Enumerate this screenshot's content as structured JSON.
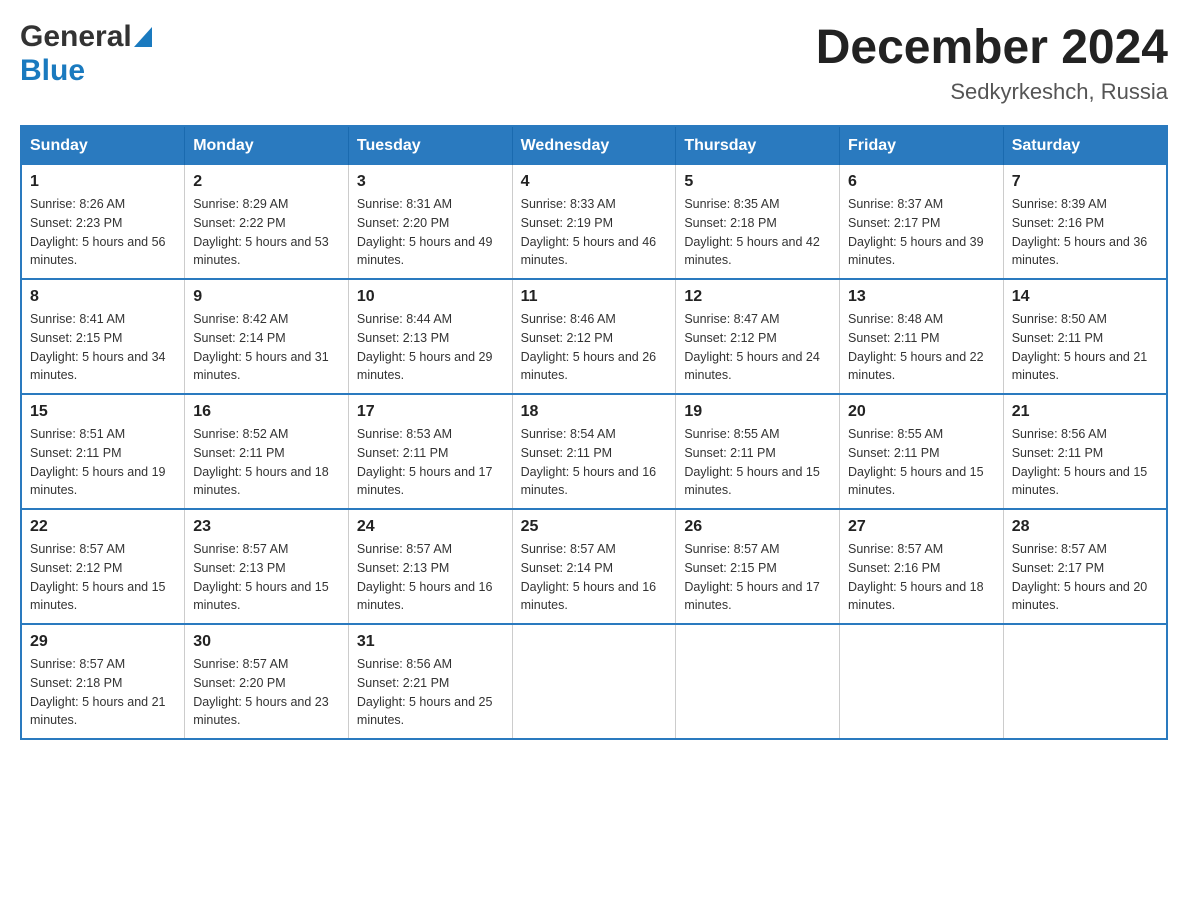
{
  "header": {
    "logo_general": "General",
    "logo_blue": "Blue",
    "month_year": "December 2024",
    "location": "Sedkyrkeshch, Russia"
  },
  "days_of_week": [
    "Sunday",
    "Monday",
    "Tuesday",
    "Wednesday",
    "Thursday",
    "Friday",
    "Saturday"
  ],
  "weeks": [
    [
      {
        "day": "1",
        "sunrise": "8:26 AM",
        "sunset": "2:23 PM",
        "daylight": "5 hours and 56 minutes."
      },
      {
        "day": "2",
        "sunrise": "8:29 AM",
        "sunset": "2:22 PM",
        "daylight": "5 hours and 53 minutes."
      },
      {
        "day": "3",
        "sunrise": "8:31 AM",
        "sunset": "2:20 PM",
        "daylight": "5 hours and 49 minutes."
      },
      {
        "day": "4",
        "sunrise": "8:33 AM",
        "sunset": "2:19 PM",
        "daylight": "5 hours and 46 minutes."
      },
      {
        "day": "5",
        "sunrise": "8:35 AM",
        "sunset": "2:18 PM",
        "daylight": "5 hours and 42 minutes."
      },
      {
        "day": "6",
        "sunrise": "8:37 AM",
        "sunset": "2:17 PM",
        "daylight": "5 hours and 39 minutes."
      },
      {
        "day": "7",
        "sunrise": "8:39 AM",
        "sunset": "2:16 PM",
        "daylight": "5 hours and 36 minutes."
      }
    ],
    [
      {
        "day": "8",
        "sunrise": "8:41 AM",
        "sunset": "2:15 PM",
        "daylight": "5 hours and 34 minutes."
      },
      {
        "day": "9",
        "sunrise": "8:42 AM",
        "sunset": "2:14 PM",
        "daylight": "5 hours and 31 minutes."
      },
      {
        "day": "10",
        "sunrise": "8:44 AM",
        "sunset": "2:13 PM",
        "daylight": "5 hours and 29 minutes."
      },
      {
        "day": "11",
        "sunrise": "8:46 AM",
        "sunset": "2:12 PM",
        "daylight": "5 hours and 26 minutes."
      },
      {
        "day": "12",
        "sunrise": "8:47 AM",
        "sunset": "2:12 PM",
        "daylight": "5 hours and 24 minutes."
      },
      {
        "day": "13",
        "sunrise": "8:48 AM",
        "sunset": "2:11 PM",
        "daylight": "5 hours and 22 minutes."
      },
      {
        "day": "14",
        "sunrise": "8:50 AM",
        "sunset": "2:11 PM",
        "daylight": "5 hours and 21 minutes."
      }
    ],
    [
      {
        "day": "15",
        "sunrise": "8:51 AM",
        "sunset": "2:11 PM",
        "daylight": "5 hours and 19 minutes."
      },
      {
        "day": "16",
        "sunrise": "8:52 AM",
        "sunset": "2:11 PM",
        "daylight": "5 hours and 18 minutes."
      },
      {
        "day": "17",
        "sunrise": "8:53 AM",
        "sunset": "2:11 PM",
        "daylight": "5 hours and 17 minutes."
      },
      {
        "day": "18",
        "sunrise": "8:54 AM",
        "sunset": "2:11 PM",
        "daylight": "5 hours and 16 minutes."
      },
      {
        "day": "19",
        "sunrise": "8:55 AM",
        "sunset": "2:11 PM",
        "daylight": "5 hours and 15 minutes."
      },
      {
        "day": "20",
        "sunrise": "8:55 AM",
        "sunset": "2:11 PM",
        "daylight": "5 hours and 15 minutes."
      },
      {
        "day": "21",
        "sunrise": "8:56 AM",
        "sunset": "2:11 PM",
        "daylight": "5 hours and 15 minutes."
      }
    ],
    [
      {
        "day": "22",
        "sunrise": "8:57 AM",
        "sunset": "2:12 PM",
        "daylight": "5 hours and 15 minutes."
      },
      {
        "day": "23",
        "sunrise": "8:57 AM",
        "sunset": "2:13 PM",
        "daylight": "5 hours and 15 minutes."
      },
      {
        "day": "24",
        "sunrise": "8:57 AM",
        "sunset": "2:13 PM",
        "daylight": "5 hours and 16 minutes."
      },
      {
        "day": "25",
        "sunrise": "8:57 AM",
        "sunset": "2:14 PM",
        "daylight": "5 hours and 16 minutes."
      },
      {
        "day": "26",
        "sunrise": "8:57 AM",
        "sunset": "2:15 PM",
        "daylight": "5 hours and 17 minutes."
      },
      {
        "day": "27",
        "sunrise": "8:57 AM",
        "sunset": "2:16 PM",
        "daylight": "5 hours and 18 minutes."
      },
      {
        "day": "28",
        "sunrise": "8:57 AM",
        "sunset": "2:17 PM",
        "daylight": "5 hours and 20 minutes."
      }
    ],
    [
      {
        "day": "29",
        "sunrise": "8:57 AM",
        "sunset": "2:18 PM",
        "daylight": "5 hours and 21 minutes."
      },
      {
        "day": "30",
        "sunrise": "8:57 AM",
        "sunset": "2:20 PM",
        "daylight": "5 hours and 23 minutes."
      },
      {
        "day": "31",
        "sunrise": "8:56 AM",
        "sunset": "2:21 PM",
        "daylight": "5 hours and 25 minutes."
      },
      null,
      null,
      null,
      null
    ]
  ],
  "labels": {
    "sunrise_prefix": "Sunrise: ",
    "sunset_prefix": "Sunset: ",
    "daylight_prefix": "Daylight: "
  }
}
